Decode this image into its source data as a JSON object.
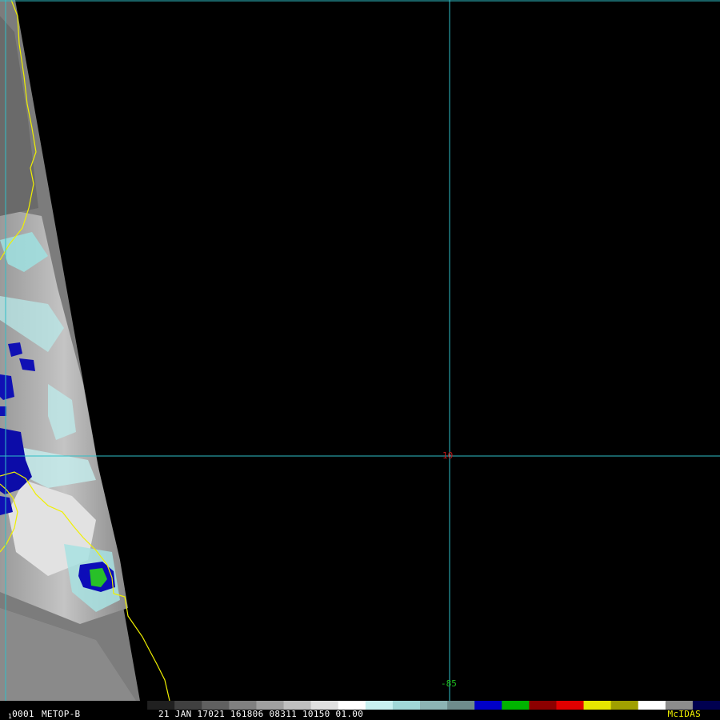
{
  "map": {
    "grid": {
      "latitude_label": "10",
      "longitude_label": "-85",
      "line_color": "#30c0c8",
      "latitude_label_color": "#c81818",
      "longitude_label_color": "#20c020"
    },
    "coastline_color": "#f0f000",
    "swath_visible": true
  },
  "status_bar": {
    "frame_prefix": "1",
    "frame_number": "0001",
    "satellite": "METOP-B",
    "datetime": "21 JAN 17021 161806 08311 10150 01.00",
    "logo": "McIDAS"
  },
  "colorbar": {
    "segments": [
      {
        "color": "#000000"
      },
      {
        "color": "#202020"
      },
      {
        "color": "#404040"
      },
      {
        "color": "#606060"
      },
      {
        "color": "#808080"
      },
      {
        "color": "#a0a0a0"
      },
      {
        "color": "#c0c0c0"
      },
      {
        "color": "#e0e0e0"
      },
      {
        "color": "#ffffff"
      },
      {
        "color": "#c8f0f0"
      },
      {
        "color": "#a0d8d8"
      },
      {
        "color": "#8cb4b4"
      },
      {
        "color": "#6e8c8c"
      },
      {
        "color": "#0000c8"
      },
      {
        "color": "#00b400"
      },
      {
        "color": "#8c0000"
      },
      {
        "color": "#e00000"
      },
      {
        "color": "#e6e600"
      },
      {
        "color": "#a0a000"
      },
      {
        "color": "#ffffff"
      },
      {
        "color": "#8c8c8c"
      },
      {
        "color": "#000050"
      }
    ]
  }
}
